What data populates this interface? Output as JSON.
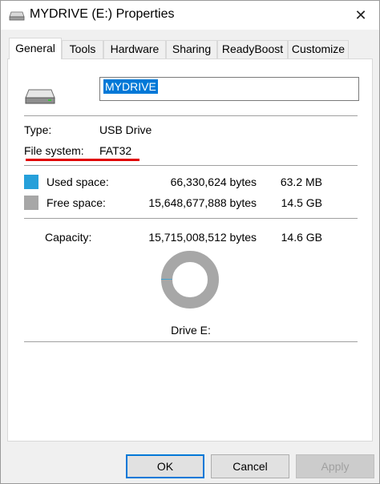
{
  "window": {
    "title": "MYDRIVE (E:) Properties",
    "close_glyph": "✕",
    "title_icon": "drive-icon"
  },
  "tabs": [
    {
      "label": "General",
      "active": true
    },
    {
      "label": "Tools"
    },
    {
      "label": "Hardware"
    },
    {
      "label": "Sharing"
    },
    {
      "label": "ReadyBoost"
    },
    {
      "label": "Customize"
    }
  ],
  "general": {
    "drive_name": "MYDRIVE",
    "type_label": "Type:",
    "type_value": "USB Drive",
    "fs_label": "File system:",
    "fs_value": "FAT32",
    "used_label": "Used space:",
    "used_bytes": "66,330,624 bytes",
    "used_human": "63.2 MB",
    "free_label": "Free space:",
    "free_bytes": "15,648,677,888 bytes",
    "free_human": "14.5 GB",
    "capacity_label": "Capacity:",
    "capacity_bytes": "15,715,008,512 bytes",
    "capacity_human": "14.6 GB",
    "drive_caption": "Drive E:",
    "used_fraction": 0.0042
  },
  "colors": {
    "used": "#26a0da",
    "free": "#a7a7a7",
    "selection": "#0078d7",
    "highlight_underline": "#e00000"
  },
  "buttons": {
    "ok": "OK",
    "cancel": "Cancel",
    "apply": "Apply"
  }
}
